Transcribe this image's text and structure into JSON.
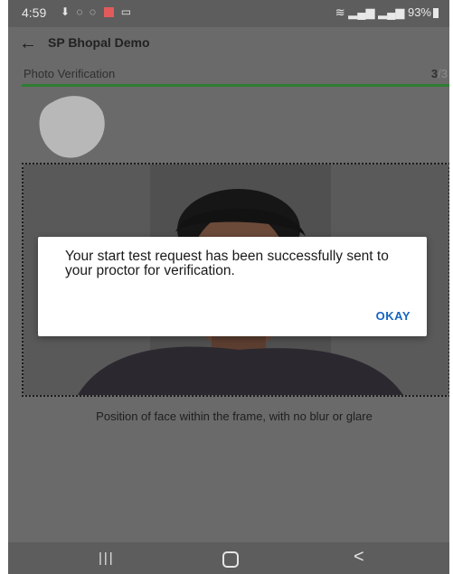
{
  "status_bar": {
    "time": "4:59",
    "battery": "93%",
    "left_icons": [
      "notification-icon",
      "whatsapp-icon",
      "whatsapp-icon",
      "app-icon",
      "message-icon"
    ],
    "right_icons": [
      "wifi-icon",
      "signal-icon",
      "signal-icon"
    ]
  },
  "header": {
    "title": "SP Bhopal Demo"
  },
  "step": {
    "label": "Photo Verification",
    "current": "3",
    "total": "/3",
    "progress": 1.0
  },
  "hint": "Position of face within the frame, with no blur or glare",
  "dialog": {
    "message": "Your start test request has been successfully sent to your proctor for verification.",
    "ok_label": "OKAY"
  },
  "nav": {
    "recents": "|||",
    "back": "<"
  },
  "colors": {
    "accent_green": "#2e7d32",
    "dialog_button": "#1565c0",
    "scrim": "#6a6a6a"
  }
}
